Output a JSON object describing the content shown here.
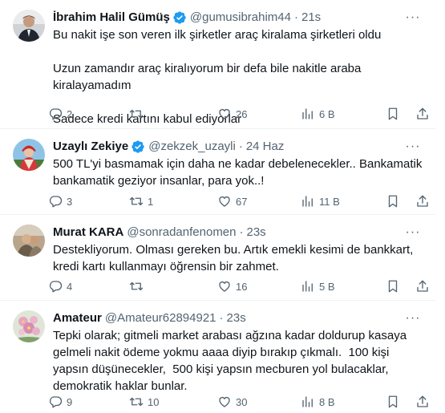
{
  "tweets": [
    {
      "name": "İbrahim Halil Gümüş",
      "verified": true,
      "handle": "@gumusibrahim44",
      "time": "21s",
      "text": "Bu nakit işe son veren ilk şirketler araç kiralama şirketleri oldu\n\nUzun zamandır araç kiralıyorum bir defa bile nakitle araba kiralayamadım\n\nSadece kredi kartını kabul ediyorlar",
      "replies": "2",
      "retweets": "",
      "likes": "26",
      "views": "6 B"
    },
    {
      "name": "Uzaylı Zekiye",
      "verified": true,
      "handle": "@zekzek_uzayli",
      "time": "24 Haz",
      "text": "500 TL'yi basmamak için daha ne kadar debelenecekler.. Bankamatik bankamatik geziyor insanlar, para yok..!",
      "replies": "3",
      "retweets": "1",
      "likes": "67",
      "views": "11 B"
    },
    {
      "name": "Murat KARA",
      "verified": false,
      "handle": "@sonradanfenomen",
      "time": "23s",
      "text": "Destekliyorum. Olması gereken bu. Artık emekli kesimi de bankkart, kredi kartı kullanmayı öğrensin bir zahmet.",
      "replies": "4",
      "retweets": "",
      "likes": "16",
      "views": "5 B"
    },
    {
      "name": "Amateur",
      "verified": false,
      "handle": "@Amateur62894921",
      "time": "23s",
      "text": "Tepki olarak; gitmeli market arabası ağzına kadar doldurup kasaya gelmeli nakit ödeme yokmu aaaa diyip bırakıp çıkmalı.  100 kişi yapsın düşünecekler,  500 kişi yapsın mecburen yol bulacaklar,  demokratik haklar bunlar.",
      "replies": "9",
      "retweets": "10",
      "likes": "30",
      "views": "8 B"
    }
  ],
  "colors": {
    "verified": "#1d9bf0",
    "muted": "#536471",
    "text": "#0f1419",
    "divider": "#eff3f4"
  },
  "icons": [
    "more-icon",
    "verified-badge-icon",
    "reply-icon",
    "retweet-icon",
    "like-icon",
    "views-icon",
    "bookmark-icon",
    "share-icon"
  ]
}
